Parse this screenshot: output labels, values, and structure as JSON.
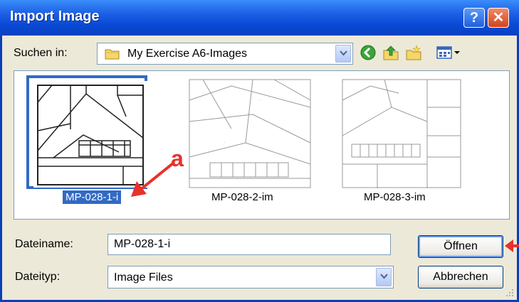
{
  "window": {
    "title": "Import Image",
    "help_label": "?",
    "close_label": "✕"
  },
  "lookin": {
    "label": "Suchen in:",
    "value": "My Exercise A6-Images"
  },
  "toolbar": {
    "icons": [
      "back-icon",
      "up-folder-icon",
      "new-folder-icon",
      "view-menu-icon"
    ]
  },
  "files": [
    {
      "name": "MP-028-1-i",
      "selected": true
    },
    {
      "name": "MP-028-2-im",
      "selected": false
    },
    {
      "name": "MP-028-3-im",
      "selected": false
    }
  ],
  "annotation": {
    "label": "a",
    "color": "#e8312a"
  },
  "filename": {
    "label": "Dateiname:",
    "value": "MP-028-1-i"
  },
  "filetype": {
    "label": "Dateityp:",
    "value": "Image Files"
  },
  "buttons": {
    "open": "Öffnen",
    "cancel": "Abbrechen"
  },
  "colors": {
    "titlebar": "#0a49d6",
    "selection": "#316ac5",
    "dialog_bg": "#ece9d8"
  }
}
